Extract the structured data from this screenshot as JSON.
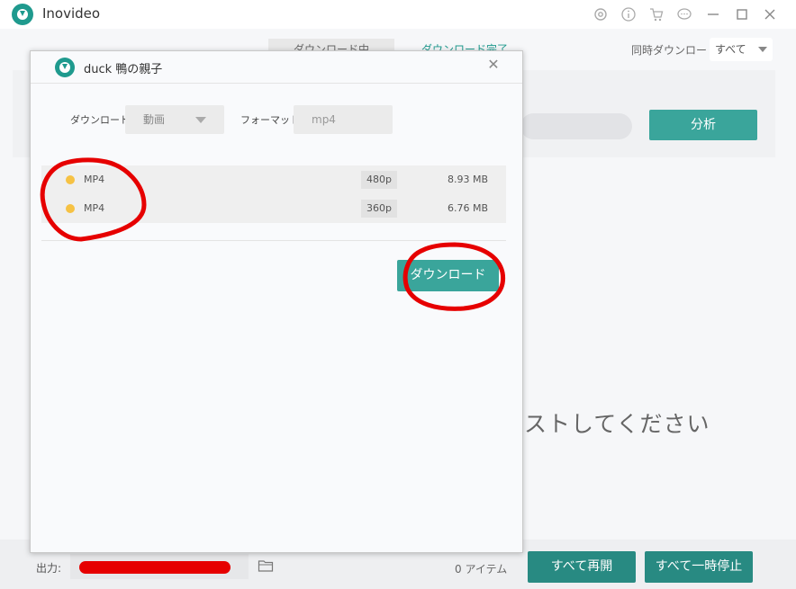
{
  "app": {
    "title": "Inovideo"
  },
  "titlebar_icons": [
    "gear-icon",
    "info-icon",
    "cart-icon",
    "chat-icon",
    "minimize-icon",
    "maximize-icon",
    "close-icon"
  ],
  "tabs": {
    "downloading": "ダウンロード中",
    "completed": "ダウンロード完了"
  },
  "concurrent": {
    "label": "同時ダウンロード",
    "value": "すべて"
  },
  "url_panel": {
    "analyze_label": "分析"
  },
  "empty_hint": "ストしてください",
  "bottom": {
    "output_label": "出力:",
    "item_count": "0 アイテム",
    "resume_all": "すべて再開",
    "pause_all": "すべて一時停止"
  },
  "dialog": {
    "title": "duck 鴨の親子",
    "download_label": "ダウンロード:",
    "download_type": "動画",
    "format_label": "フォーマット:",
    "format_value": "mp4",
    "options": [
      {
        "format": "MP4",
        "resolution": "480p",
        "size": "8.93 MB"
      },
      {
        "format": "MP4",
        "resolution": "360p",
        "size": "6.76 MB"
      }
    ],
    "download_button": "ダウンロード"
  },
  "colors": {
    "accent": "#3aa59b",
    "accent_dark": "#288a82",
    "dot": "#f6c244",
    "annotation": "#e60000"
  }
}
